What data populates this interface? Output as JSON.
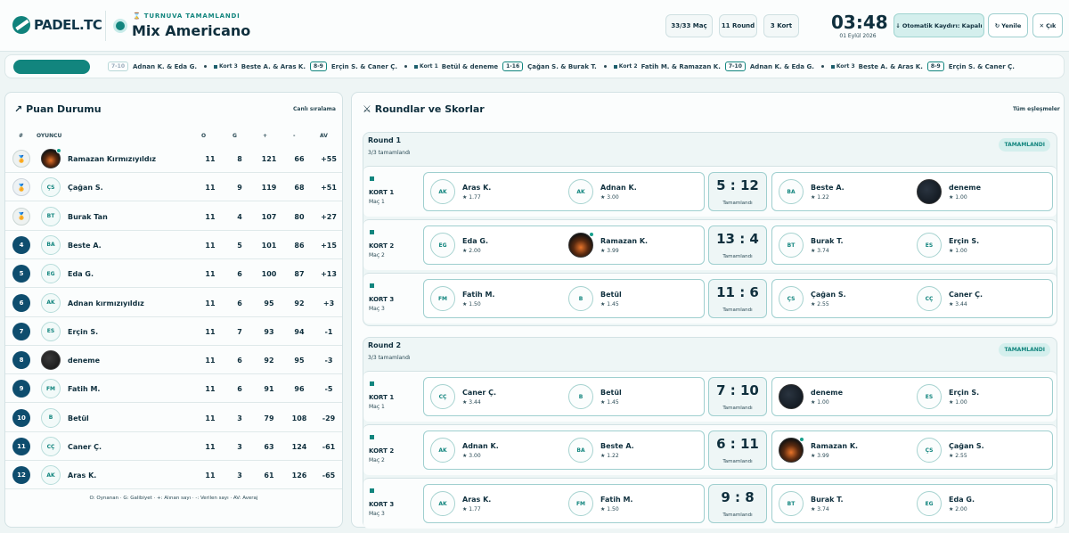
{
  "header": {
    "logo_text": "PADEL.TC",
    "tournament_status": "TURNUVA TAMAMLANDI",
    "tournament_name": "Mix Americano",
    "stats": [
      "33/33 Maç",
      "11 Round",
      "3 Kort"
    ],
    "clock": "03:48",
    "date": "01 Eylül 2026",
    "auto_save_label": "Otomatik Kaydırı: Kapalı",
    "refresh_label": "Yenile",
    "exit_label": "Çık"
  },
  "ticker": [
    {
      "court": "",
      "team1": "",
      "score": "7-10",
      "team2": "Adnan K. & Eda G."
    },
    {
      "court": "Kort 3",
      "team1": "Beste A. & Aras K.",
      "score": "8-9",
      "team2": "Erçin S. & Caner Ç."
    },
    {
      "court": "Kort 1",
      "team1": "Betül & deneme",
      "score": "1-16",
      "team2": "Çağan S. & Burak T."
    },
    {
      "court": "Kort 2",
      "team1": "Fatih M. & Ramazan K.",
      "score": "7-10",
      "team2": "Adnan K. & Eda G."
    },
    {
      "court": "Kort 3",
      "team1": "Beste A. & Aras K.",
      "score": "8-9",
      "team2": "Erçin S. & Caner Ç."
    }
  ],
  "standings": {
    "title": "Puan Durumu",
    "subtitle": "Canlı sıralama",
    "columns": [
      "#",
      "OYUNCU",
      "O",
      "G",
      "+",
      "-",
      "AV"
    ],
    "rows": [
      {
        "rank": "🏅",
        "name": "Ramazan Kırmızıyıldız",
        "initials": "",
        "avatar": "fire",
        "online": true,
        "o": "11",
        "g": "8",
        "plus": "121",
        "minus": "66",
        "av": "+55"
      },
      {
        "rank": "🏅",
        "name": "Çağan S.",
        "initials": "ÇS",
        "avatar": "",
        "online": false,
        "o": "11",
        "g": "9",
        "plus": "119",
        "minus": "68",
        "av": "+51"
      },
      {
        "rank": "🏅",
        "name": "Burak Tan",
        "initials": "BT",
        "avatar": "",
        "online": false,
        "o": "11",
        "g": "4",
        "plus": "107",
        "minus": "80",
        "av": "+27"
      },
      {
        "rank": "4",
        "name": "Beste A.",
        "initials": "BA",
        "avatar": "",
        "online": false,
        "o": "11",
        "g": "5",
        "plus": "101",
        "minus": "86",
        "av": "+15"
      },
      {
        "rank": "5",
        "name": "Eda G.",
        "initials": "EG",
        "avatar": "",
        "online": false,
        "o": "11",
        "g": "6",
        "plus": "100",
        "minus": "87",
        "av": "+13"
      },
      {
        "rank": "6",
        "name": "Adnan kırmızıyıldız",
        "initials": "AK",
        "avatar": "",
        "online": false,
        "o": "11",
        "g": "6",
        "plus": "95",
        "minus": "92",
        "av": "+3"
      },
      {
        "rank": "7",
        "name": "Erçin S.",
        "initials": "ES",
        "avatar": "",
        "online": false,
        "o": "11",
        "g": "7",
        "plus": "93",
        "minus": "94",
        "av": "-1"
      },
      {
        "rank": "8",
        "name": "deneme",
        "initials": "",
        "avatar": "dark",
        "online": false,
        "o": "11",
        "g": "6",
        "plus": "92",
        "minus": "95",
        "av": "-3"
      },
      {
        "rank": "9",
        "name": "Fatih M.",
        "initials": "FM",
        "avatar": "",
        "online": false,
        "o": "11",
        "g": "6",
        "plus": "91",
        "minus": "96",
        "av": "-5"
      },
      {
        "rank": "10",
        "name": "Betül",
        "initials": "B",
        "avatar": "",
        "online": false,
        "o": "11",
        "g": "3",
        "plus": "79",
        "minus": "108",
        "av": "-29"
      },
      {
        "rank": "11",
        "name": "Caner Ç.",
        "initials": "CÇ",
        "avatar": "",
        "online": false,
        "o": "11",
        "g": "3",
        "plus": "63",
        "minus": "124",
        "av": "-61"
      },
      {
        "rank": "12",
        "name": "Aras K.",
        "initials": "AK",
        "avatar": "",
        "online": false,
        "o": "11",
        "g": "3",
        "plus": "61",
        "minus": "126",
        "av": "-65"
      }
    ],
    "legend": "O: Oynanan · G: Galibiyet · +: Alınan sayı · -: Verilen sayı · AV: Averaj"
  },
  "rounds_panel": {
    "title": "Roundlar ve Skorlar",
    "subtitle": "Tüm eşleşmeler"
  },
  "rounds": [
    {
      "name": "Round 1",
      "progress": "3/3 tamamlandı",
      "badge": "TAMAMLANDI",
      "matches": [
        {
          "court": "KORT 1",
          "match": "Maç 1",
          "score": "5 : 12",
          "status": "Tamamlandı",
          "team1": [
            {
              "initials": "AK",
              "name": "Aras K.",
              "rating": "★ 1.77",
              "avatar": "",
              "online": false
            },
            {
              "initials": "AK",
              "name": "Adnan K.",
              "rating": "★ 3.00",
              "avatar": "",
              "online": false
            }
          ],
          "team2": [
            {
              "initials": "BA",
              "name": "Beste A.",
              "rating": "★ 1.22",
              "avatar": "",
              "online": false
            },
            {
              "initials": "",
              "name": "deneme",
              "rating": "★ 1.00",
              "avatar": "dark",
              "online": false
            }
          ]
        },
        {
          "court": "KORT 2",
          "match": "Maç 2",
          "score": "13 : 4",
          "status": "Tamamlandı",
          "team1": [
            {
              "initials": "EG",
              "name": "Eda G.",
              "rating": "★ 2.00",
              "avatar": "",
              "online": false
            },
            {
              "initials": "",
              "name": "Ramazan K.",
              "rating": "★ 3.99",
              "avatar": "fire",
              "online": true
            }
          ],
          "team2": [
            {
              "initials": "BT",
              "name": "Burak T.",
              "rating": "★ 3.74",
              "avatar": "",
              "online": false
            },
            {
              "initials": "ES",
              "name": "Erçin S.",
              "rating": "★ 1.00",
              "avatar": "",
              "online": false
            }
          ]
        },
        {
          "court": "KORT 3",
          "match": "Maç 3",
          "score": "11 : 6",
          "status": "Tamamlandı",
          "team1": [
            {
              "initials": "FM",
              "name": "Fatih M.",
              "rating": "★ 1.50",
              "avatar": "",
              "online": false
            },
            {
              "initials": "B",
              "name": "Betül",
              "rating": "★ 1.45",
              "avatar": "",
              "online": false
            }
          ],
          "team2": [
            {
              "initials": "ÇS",
              "name": "Çağan S.",
              "rating": "★ 2.55",
              "avatar": "",
              "online": false
            },
            {
              "initials": "CÇ",
              "name": "Caner Ç.",
              "rating": "★ 3.44",
              "avatar": "",
              "online": false
            }
          ]
        }
      ]
    },
    {
      "name": "Round 2",
      "progress": "3/3 tamamlandı",
      "badge": "TAMAMLANDI",
      "matches": [
        {
          "court": "KORT 1",
          "match": "Maç 1",
          "score": "7 : 10",
          "status": "Tamamlandı",
          "team1": [
            {
              "initials": "CÇ",
              "name": "Caner Ç.",
              "rating": "★ 3.44",
              "avatar": "",
              "online": false
            },
            {
              "initials": "B",
              "name": "Betül",
              "rating": "★ 1.45",
              "avatar": "",
              "online": false
            }
          ],
          "team2": [
            {
              "initials": "",
              "name": "deneme",
              "rating": "★ 1.00",
              "avatar": "dark",
              "online": false
            },
            {
              "initials": "ES",
              "name": "Erçin S.",
              "rating": "★ 1.00",
              "avatar": "",
              "online": false
            }
          ]
        },
        {
          "court": "KORT 2",
          "match": "Maç 2",
          "score": "6 : 11",
          "status": "Tamamlandı",
          "team1": [
            {
              "initials": "AK",
              "name": "Adnan K.",
              "rating": "★ 3.00",
              "avatar": "",
              "online": false
            },
            {
              "initials": "BA",
              "name": "Beste A.",
              "rating": "★ 1.22",
              "avatar": "",
              "online": false
            }
          ],
          "team2": [
            {
              "initials": "",
              "name": "Ramazan K.",
              "rating": "★ 3.99",
              "avatar": "fire",
              "online": true
            },
            {
              "initials": "ÇS",
              "name": "Çağan S.",
              "rating": "★ 2.55",
              "avatar": "",
              "online": false
            }
          ]
        },
        {
          "court": "KORT 3",
          "match": "Maç 3",
          "score": "9 : 8",
          "status": "Tamamlandı",
          "team1": [
            {
              "initials": "AK",
              "name": "Aras K.",
              "rating": "★ 1.77",
              "avatar": "",
              "online": false
            },
            {
              "initials": "FM",
              "name": "Fatih M.",
              "rating": "★ 1.50",
              "avatar": "",
              "online": false
            }
          ],
          "team2": [
            {
              "initials": "BT",
              "name": "Burak T.",
              "rating": "★ 3.74",
              "avatar": "",
              "online": false
            },
            {
              "initials": "EG",
              "name": "Eda G.",
              "rating": "★ 2.00",
              "avatar": "",
              "online": false
            }
          ]
        }
      ]
    }
  ],
  "colors": {
    "accent": "#12857e",
    "dark": "#0e4d6e",
    "background": "#eef5f5"
  }
}
